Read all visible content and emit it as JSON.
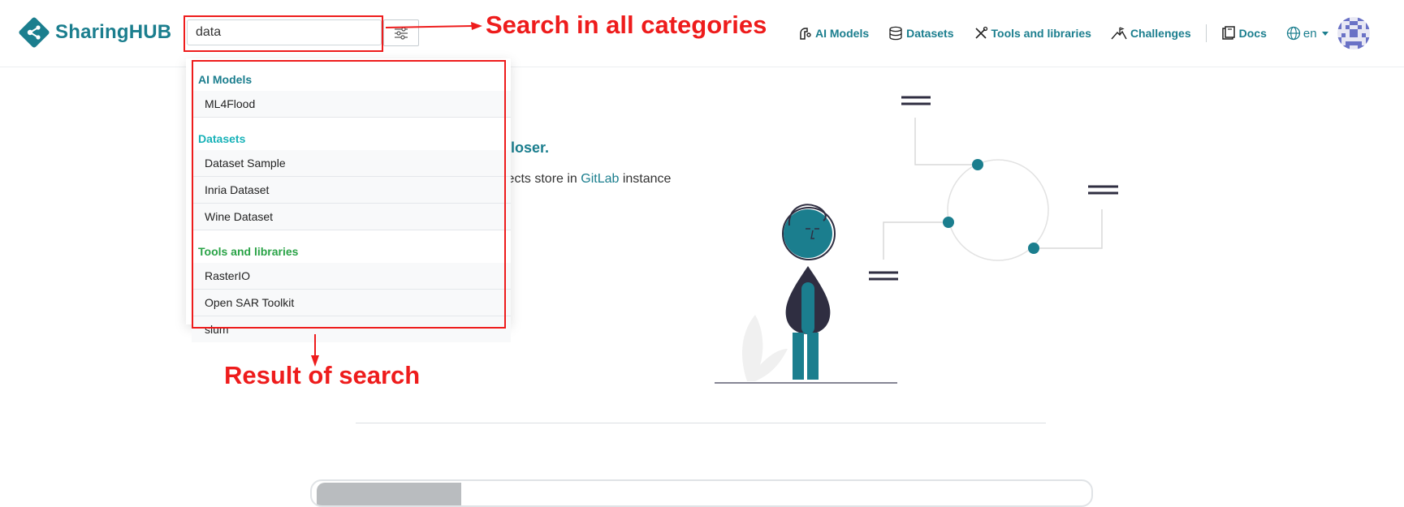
{
  "brand": {
    "name": "SharingHUB"
  },
  "search": {
    "value": "data",
    "placeholder": ""
  },
  "nav": {
    "items": [
      {
        "label": "AI Models",
        "icon": "ai-models-icon"
      },
      {
        "label": "Datasets",
        "icon": "database-icon"
      },
      {
        "label": "Tools and libraries",
        "icon": "tools-icon"
      },
      {
        "label": "Challenges",
        "icon": "mountain-flag-icon"
      },
      {
        "label": "Docs",
        "icon": "book-icon"
      }
    ],
    "language": "en"
  },
  "dropdown": {
    "groups": [
      {
        "title": "AI Models",
        "color": "#1b7e8e",
        "items": [
          "ML4Flood"
        ]
      },
      {
        "title": "Datasets",
        "color": "#17b2b8",
        "items": [
          "Dataset Sample",
          "Inria Dataset",
          "Wine Dataset"
        ]
      },
      {
        "title": "Tools and libraries",
        "color": "#2aa347",
        "items": [
          "RasterIO",
          "Open SAR Toolkit",
          "slum"
        ]
      }
    ]
  },
  "hero": {
    "title_fragment": "loser.",
    "text_before": "jects store in ",
    "text_link": "GitLab",
    "text_after": " instance"
  },
  "annotations": {
    "search_note": "Search in all categories",
    "result_note": "Result of search"
  },
  "colors": {
    "brand": "#1b7e8e",
    "annotation": "#ee1c1c",
    "illustration_dark": "#2f2e41"
  }
}
